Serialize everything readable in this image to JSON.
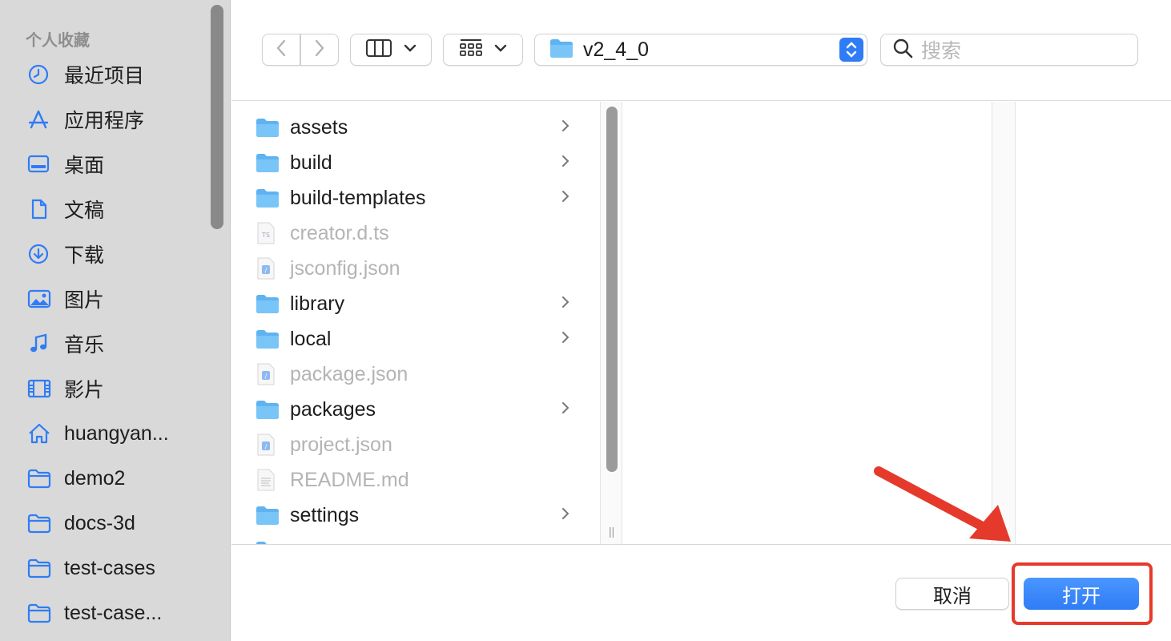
{
  "sidebar": {
    "section_title": "个人收藏",
    "items": [
      {
        "label": "最近项目",
        "icon": "clock-icon"
      },
      {
        "label": "应用程序",
        "icon": "apps-icon"
      },
      {
        "label": "桌面",
        "icon": "desktop-icon"
      },
      {
        "label": "文稿",
        "icon": "document-icon"
      },
      {
        "label": "下载",
        "icon": "download-icon"
      },
      {
        "label": "图片",
        "icon": "photo-icon"
      },
      {
        "label": "音乐",
        "icon": "music-icon"
      },
      {
        "label": "影片",
        "icon": "film-icon"
      },
      {
        "label": "huangyan...",
        "icon": "home-icon"
      },
      {
        "label": "demo2",
        "icon": "folder-icon"
      },
      {
        "label": "docs-3d",
        "icon": "folder-icon"
      },
      {
        "label": "test-cases",
        "icon": "folder-icon"
      },
      {
        "label": "test-case...",
        "icon": "folder-icon"
      }
    ]
  },
  "toolbar": {
    "path_folder": "v2_4_0",
    "search_placeholder": "搜索"
  },
  "files": [
    {
      "name": "assets",
      "type": "folder",
      "enabled": true
    },
    {
      "name": "build",
      "type": "folder",
      "enabled": true
    },
    {
      "name": "build-templates",
      "type": "folder",
      "enabled": true
    },
    {
      "name": "creator.d.ts",
      "type": "ts",
      "enabled": false
    },
    {
      "name": "jsconfig.json",
      "type": "json",
      "enabled": false
    },
    {
      "name": "library",
      "type": "folder",
      "enabled": true
    },
    {
      "name": "local",
      "type": "folder",
      "enabled": true
    },
    {
      "name": "package.json",
      "type": "json",
      "enabled": false
    },
    {
      "name": "packages",
      "type": "folder",
      "enabled": true
    },
    {
      "name": "project.json",
      "type": "json",
      "enabled": false
    },
    {
      "name": "README.md",
      "type": "md",
      "enabled": false
    },
    {
      "name": "settings",
      "type": "folder",
      "enabled": true
    }
  ],
  "buttons": {
    "cancel": "取消",
    "open": "打开"
  },
  "colors": {
    "accent": "#2f7cf6",
    "folder": "#5fb3f0",
    "annotation": "#e53a2b"
  }
}
